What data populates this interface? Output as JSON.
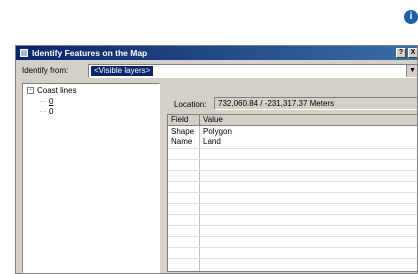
{
  "dialog": {
    "title": "Identify Features on the Map",
    "help_button": "?",
    "close_button": "X"
  },
  "identify": {
    "label": "Identify from:",
    "selected": "<Visible layers>"
  },
  "tree": {
    "root": {
      "label": "Coast lines",
      "expander": "-",
      "children": [
        "0",
        "0"
      ]
    }
  },
  "location": {
    "label": "Location:",
    "value": "732,060.84 / -231,317.37 Meters"
  },
  "results": {
    "columns": [
      "Field",
      "Value"
    ],
    "rows": [
      {
        "field": "Shape",
        "value": "Polygon"
      },
      {
        "field": "Name",
        "value": "Land"
      }
    ]
  },
  "icons": {
    "help_badge": "info-badge-icon",
    "title": "identify-icon",
    "dropdown": "chevron-down-icon"
  },
  "colors": {
    "title_bar": "#0a246a",
    "selection": "#0a246a",
    "dialog_bg": "#d4d0c8",
    "help_badge": "#1f5fa8"
  }
}
